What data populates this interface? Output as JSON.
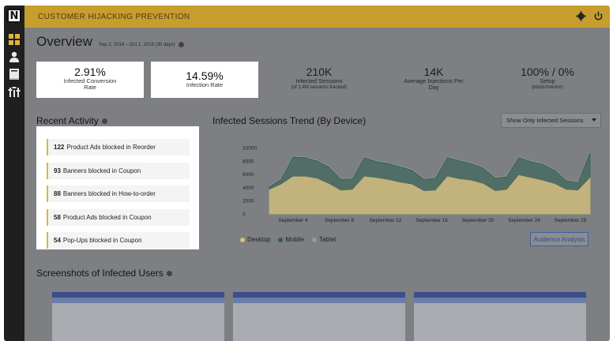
{
  "app": {
    "logo_letter": "N",
    "title": "CUSTOMER HIJACKING PREVENTION"
  },
  "overview": {
    "title": "Overview",
    "date_range": "Sep 2, 2018 – Oct 1, 2018 (30 days)"
  },
  "stats": [
    {
      "value": "2.91%",
      "label": "Infected Conversion Rate"
    },
    {
      "value": "14.59%",
      "label": "Infection Rate"
    },
    {
      "value": "210K",
      "label": "Infected Sessions",
      "sub": "(of 1.4M sessions tracked)"
    },
    {
      "value": "14K",
      "label": "Average Injections Per Day"
    },
    {
      "value": "100% / 0%",
      "label": "Setup",
      "sub": "(block/monitor)"
    }
  ],
  "recent_activity": {
    "title": "Recent Activity",
    "items": [
      {
        "count": "122",
        "text": "Product Ads blocked in Reorder"
      },
      {
        "count": "93",
        "text": "Banners blocked in Coupon"
      },
      {
        "count": "88",
        "text": "Banners blocked in How-to-order"
      },
      {
        "count": "58",
        "text": "Product Ads blocked in Coupon"
      },
      {
        "count": "54",
        "text": "Pop-Ups blocked in Coupon"
      }
    ]
  },
  "trend": {
    "title": "Infected Sessions Trend (By Device)",
    "filter_label": "Show Only Infected Sessions",
    "analysis_button": "Audience Analysis",
    "legend": [
      "Desktop",
      "Mobile",
      "Tablet"
    ]
  },
  "screenshots": {
    "title": "Screenshots of Infected Users"
  },
  "colors": {
    "accent": "#c79d2e",
    "desktop": "#d9c27a",
    "mobile": "#3f6e5f",
    "tablet": "#9a9a9a"
  },
  "chart_data": {
    "type": "area",
    "ylim": [
      0,
      10000
    ],
    "yticks": [
      "10000",
      "8000",
      "6000",
      "4000",
      "2000",
      "0"
    ],
    "xticks": [
      "September 4",
      "September 8",
      "September 12",
      "September 16",
      "September 20",
      "September 24",
      "September 28"
    ],
    "series": [
      {
        "name": "Desktop",
        "values": [
          3600,
          4400,
          5600,
          5600,
          5300,
          4500,
          3500,
          3600,
          5600,
          5400,
          5100,
          4700,
          4400,
          3400,
          3500,
          5600,
          5200,
          5000,
          4500,
          3400,
          3600,
          5800,
          5400,
          5000,
          4500,
          3600,
          3500,
          5400
        ]
      },
      {
        "name": "Mobile",
        "values": [
          4100,
          5200,
          8600,
          8500,
          8000,
          7100,
          5200,
          5300,
          8500,
          7900,
          7600,
          7100,
          6600,
          5200,
          5400,
          8500,
          8000,
          7600,
          6900,
          5400,
          5600,
          8500,
          7900,
          7500,
          6600,
          5000,
          4700,
          9200
        ]
      },
      {
        "name": "Tablet",
        "values": [
          4200,
          5300,
          8700,
          8600,
          8100,
          7200,
          5300,
          5400,
          8600,
          8000,
          7700,
          7200,
          6700,
          5300,
          5500,
          8600,
          8100,
          7700,
          7000,
          5500,
          5700,
          8600,
          8000,
          7600,
          6700,
          5100,
          4800,
          9300
        ]
      }
    ]
  }
}
